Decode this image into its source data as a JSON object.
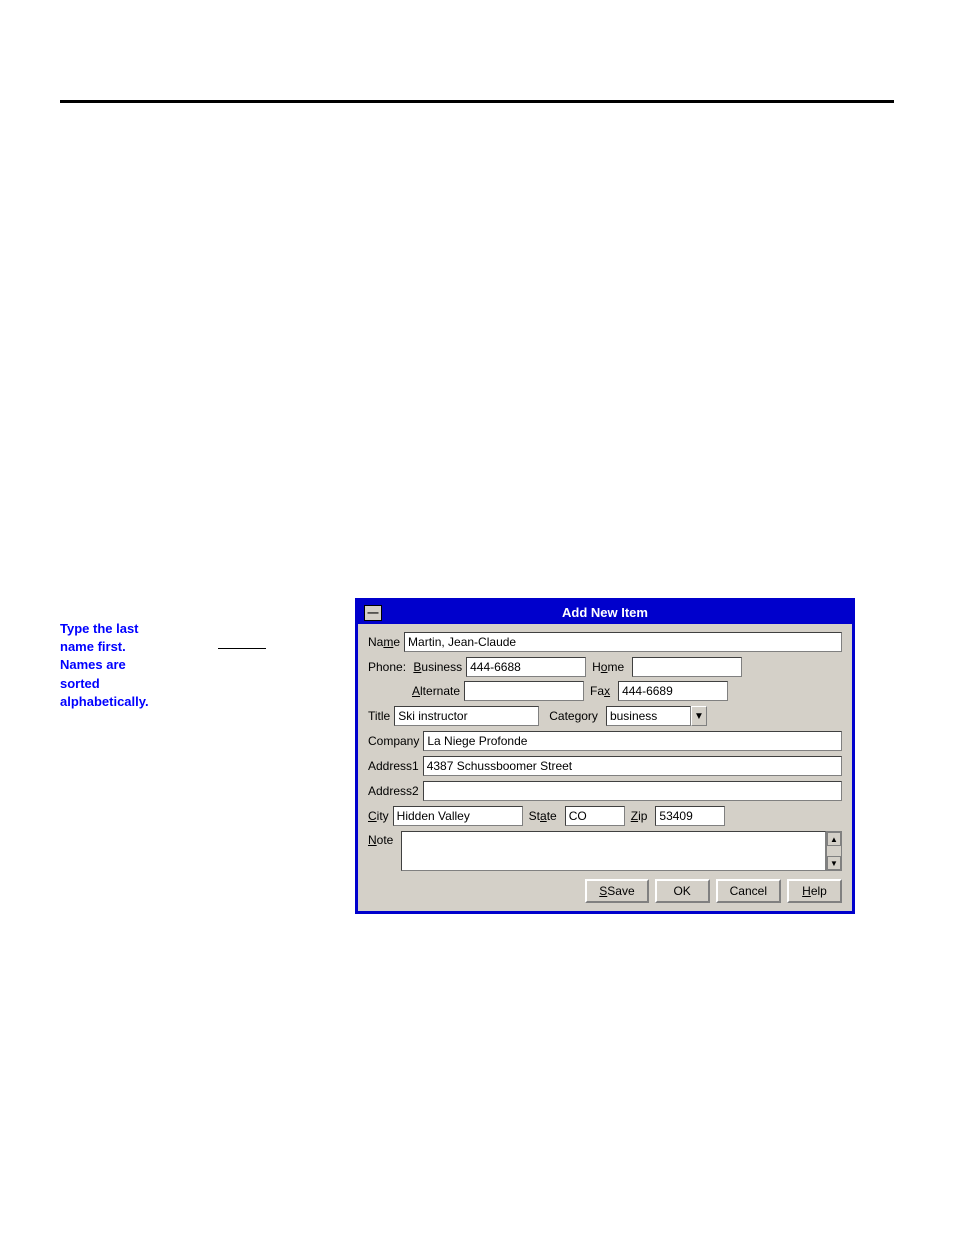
{
  "page": {
    "annotation": {
      "line1": "Type the last",
      "line2": "name first.",
      "line3": "Names are",
      "line4": "sorted",
      "line5": "alphabetically."
    },
    "dialog": {
      "title": "Add New Item",
      "titlebar_btn": "—",
      "fields": {
        "name_label": "Name",
        "name_value": "Martin, Jean-Claude",
        "phone_label": "Phone:",
        "business_label": "Business",
        "business_value": "444-6688",
        "home_label": "Home",
        "home_value": "",
        "alternate_label": "Alternate",
        "alternate_value": "",
        "fax_label": "Fax",
        "fax_value": "444-6689",
        "title_label": "Title",
        "title_value": "Ski instructor",
        "category_label": "Category",
        "category_value": "business",
        "company_label": "Company",
        "company_value": "La Niege Profonde",
        "address1_label": "Address1",
        "address1_value": "4387 Schussboomer Street",
        "address2_label": "Address2",
        "address2_value": "",
        "city_label": "City",
        "city_value": "Hidden Valley",
        "state_label": "State",
        "state_value": "CO",
        "zip_label": "Zip",
        "zip_value": "53409",
        "note_label": "Note",
        "note_value": ""
      },
      "buttons": {
        "save": "Save",
        "ok": "OK",
        "cancel": "Cancel",
        "help": "Help"
      }
    }
  }
}
